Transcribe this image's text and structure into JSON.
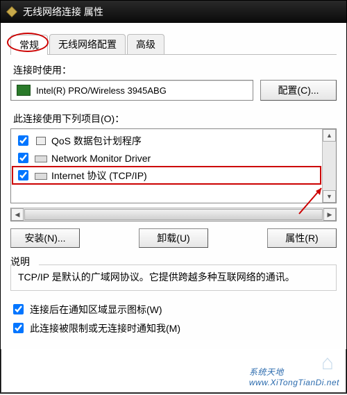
{
  "window": {
    "title": "无线网络连接 属性"
  },
  "tabs": {
    "general": "常规",
    "wireless": "无线网络配置",
    "advanced": "高级"
  },
  "connect_using_label": "连接时使用：",
  "adapter": {
    "name": "Intel(R) PRO/Wireless 3945ABG"
  },
  "configure_button": "配置(C)...",
  "items_label": "此连接使用下列项目(O)：",
  "items": {
    "qos": "QoS 数据包计划程序",
    "nm": "Network Monitor Driver",
    "tcpip": "Internet 协议 (TCP/IP)"
  },
  "buttons": {
    "install": "安装(N)...",
    "uninstall": "卸载(U)",
    "properties": "属性(R)"
  },
  "description": {
    "heading": "说明",
    "text": "TCP/IP 是默认的广域网协议。它提供跨越多种互联网络的通讯。"
  },
  "checkboxes": {
    "show_icon": "连接后在通知区域显示图标(W)",
    "notify_limited": "此连接被限制或无连接时通知我(M)"
  },
  "watermark": {
    "brand": "系统天地",
    "url": "www.XiTongTianDi.net"
  }
}
